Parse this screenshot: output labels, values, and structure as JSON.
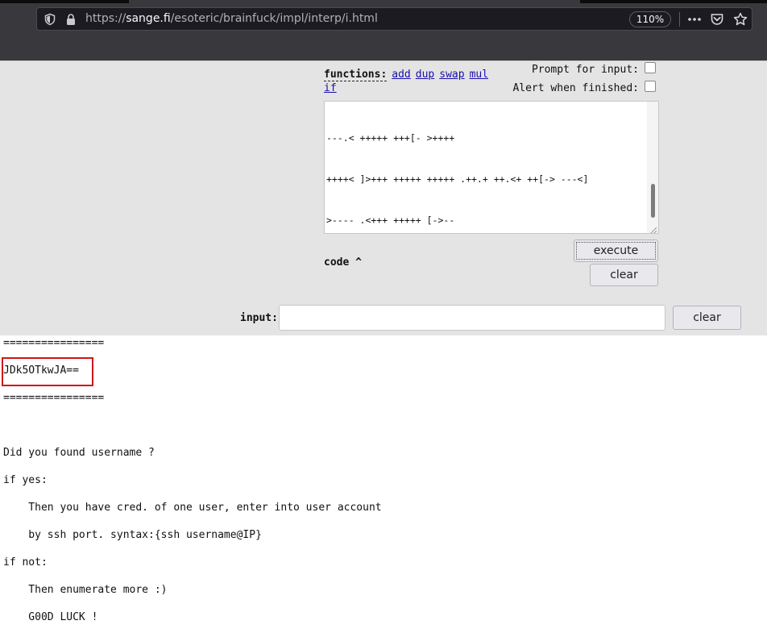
{
  "browser": {
    "url_prefix": "https://",
    "url_host": "sange.fi",
    "url_path": "/esoteric/brainfuck/impl/interp/i.html",
    "zoom": "110%",
    "icons": [
      "shield-icon",
      "lock-icon",
      "more-icon",
      "pocket-icon",
      "bookmark-star-icon"
    ]
  },
  "controls": {
    "functions_label": "functions:",
    "functions": [
      "add",
      "dup",
      "swap",
      "mul",
      "if"
    ],
    "prompt_label": "Prompt for input:",
    "alert_label": "Alert when finished:",
    "prompt_checked": false,
    "alert_checked": false
  },
  "code": {
    "lines": [
      "---.< +++++ +++[- >++++",
      "++++< ]>+++ +++++ +++++ .++.+ ++.<+ ++[-> ---<]",
      ">---- .<+++ +++++ [->--",
      "----- -<]>- ----. <++++ +[->+ ++++< ]>+.< ++++[",
      "->--- -<]>- .<+++ ++[->",
      "----- <]>-- -.--- .<+++ +[->+ +++<] >++++ ++...",
      ".<+++ +++[- >++++ ++<]>",
      "+++.< ++++[ ->--- -<]>- ----- -..<+ +++[- >++++",
      "<]>++ ++.<+ +++++ [->--",
      "----< ]>-.<+ +++++ [->++ ++++< ]>+++ +++++ .+++"
    ],
    "toggle_label": "code ^",
    "execute_label": "execute",
    "clear_label": "clear"
  },
  "input": {
    "label": "input:",
    "value": "",
    "clear_label": "clear"
  },
  "output": {
    "separator_top": "================",
    "key": "JDk5OTkwJA==",
    "separator_bottom": "================",
    "lines": [
      "Did you found username ?",
      "if yes:",
      "    Then you have cred. of one user, enter into user account",
      "    by ssh port. syntax:{ssh username@IP}",
      "if not:",
      "    Then enumerate more :)",
      "    G00D LUCK !"
    ]
  },
  "colors": {
    "highlight": "#d0141b",
    "link": "#1a0dab",
    "chrome": "#38383d"
  }
}
